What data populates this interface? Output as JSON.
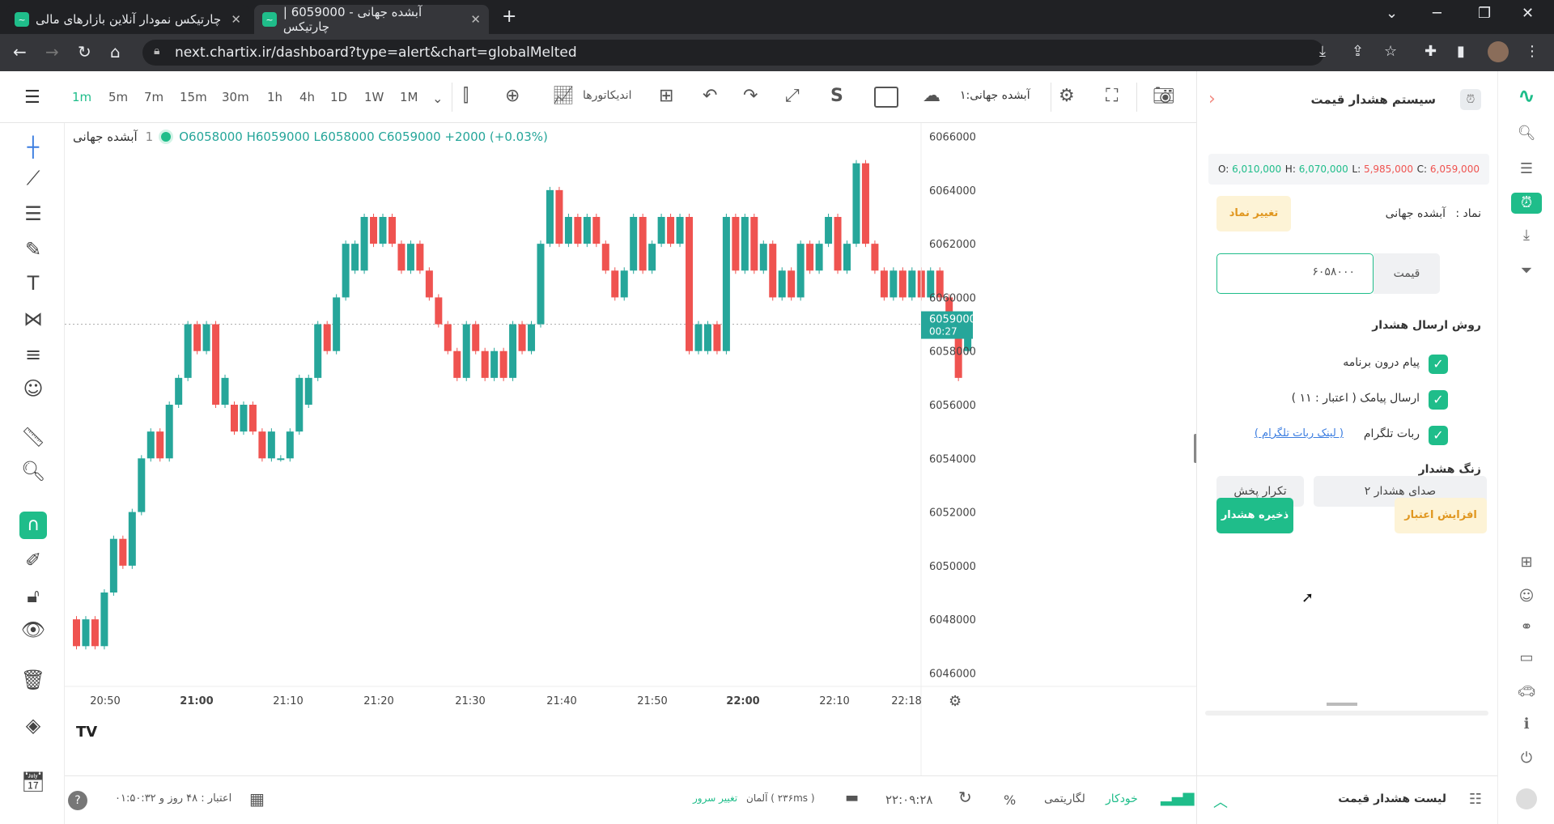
{
  "browser": {
    "tabs": [
      {
        "title": "چارتیکس نمودار آنلاین بازارهای مالی",
        "active": false
      },
      {
        "title": "آبشده جهانی - 6059000 | چارتیکس",
        "active": true
      }
    ],
    "url": "next.chartix.ir/dashboard?type=alert&chart=globalMelted"
  },
  "toolbar": {
    "timeframes": [
      "1m",
      "5m",
      "7m",
      "15m",
      "30m",
      "1h",
      "4h",
      "1D",
      "1W",
      "1M"
    ],
    "active_timeframe": "1m",
    "indicators_label": "اندیکاتورها",
    "symbol_label": "آبشده جهانی:۱",
    "s_label": "S"
  },
  "legend": {
    "symbol": "آبشده جهانی",
    "interval": "1",
    "ohlc": "O6058000 H6059000 L6058000 C6059000 +2000 (+0.03%)"
  },
  "chart_data": {
    "type": "candlestick",
    "x_ticks": [
      "20:50",
      "21:00",
      "21:10",
      "21:20",
      "21:30",
      "21:40",
      "21:50",
      "22:00",
      "22:10",
      "22:18"
    ],
    "y_ticks": [
      "6066000",
      "6064000",
      "6062000",
      "6060000",
      "6058000",
      "6056000",
      "6054000",
      "6052000",
      "6050000",
      "6048000",
      "6046000"
    ],
    "ylim": [
      6045500,
      6066500
    ],
    "last_price_label": "6059000",
    "countdown_label": "00:27",
    "up_color": "#26a69a",
    "down_color": "#ef5350",
    "candles": [
      [
        6048000,
        6047000
      ],
      [
        6047000,
        6048000
      ],
      [
        6048000,
        6047000
      ],
      [
        6047000,
        6049000
      ],
      [
        6049000,
        6051000
      ],
      [
        6051000,
        6050000
      ],
      [
        6050000,
        6052000
      ],
      [
        6052000,
        6054000
      ],
      [
        6054000,
        6055000
      ],
      [
        6055000,
        6054000
      ],
      [
        6054000,
        6056000
      ],
      [
        6056000,
        6057000
      ],
      [
        6057000,
        6059000
      ],
      [
        6059000,
        6058000
      ],
      [
        6058000,
        6059000
      ],
      [
        6059000,
        6056000
      ],
      [
        6056000,
        6057000
      ],
      [
        6056000,
        6055000
      ],
      [
        6055000,
        6056000
      ],
      [
        6056000,
        6055000
      ],
      [
        6055000,
        6054000
      ],
      [
        6054000,
        6055000
      ],
      [
        6054000,
        6054000
      ],
      [
        6054000,
        6055000
      ],
      [
        6055000,
        6057000
      ],
      [
        6056000,
        6057000
      ],
      [
        6057000,
        6059000
      ],
      [
        6059000,
        6058000
      ],
      [
        6058000,
        6060000
      ],
      [
        6060000,
        6062000
      ],
      [
        6061000,
        6062000
      ],
      [
        6061000,
        6063000
      ],
      [
        6063000,
        6062000
      ],
      [
        6062000,
        6063000
      ],
      [
        6063000,
        6062000
      ],
      [
        6062000,
        6061000
      ],
      [
        6061000,
        6062000
      ],
      [
        6062000,
        6061000
      ],
      [
        6061000,
        6060000
      ],
      [
        6060000,
        6059000
      ],
      [
        6059000,
        6058000
      ],
      [
        6058000,
        6057000
      ],
      [
        6057000,
        6059000
      ],
      [
        6059000,
        6058000
      ],
      [
        6058000,
        6057000
      ],
      [
        6057000,
        6058000
      ],
      [
        6058000,
        6057000
      ],
      [
        6057000,
        6059000
      ],
      [
        6059000,
        6058000
      ],
      [
        6058000,
        6059000
      ],
      [
        6059000,
        6062000
      ],
      [
        6062000,
        6064000
      ],
      [
        6064000,
        6062000
      ],
      [
        6062000,
        6063000
      ],
      [
        6063000,
        6062000
      ],
      [
        6062000,
        6063000
      ],
      [
        6063000,
        6062000
      ],
      [
        6062000,
        6061000
      ],
      [
        6061000,
        6060000
      ],
      [
        6060000,
        6061000
      ],
      [
        6061000,
        6063000
      ],
      [
        6063000,
        6061000
      ],
      [
        6061000,
        6062000
      ],
      [
        6062000,
        6063000
      ],
      [
        6063000,
        6062000
      ],
      [
        6062000,
        6063000
      ],
      [
        6063000,
        6058000
      ],
      [
        6058000,
        6059000
      ],
      [
        6058000,
        6059000
      ],
      [
        6059000,
        6058000
      ],
      [
        6058000,
        6063000
      ],
      [
        6063000,
        6061000
      ],
      [
        6061000,
        6063000
      ],
      [
        6063000,
        6061000
      ],
      [
        6061000,
        6062000
      ],
      [
        6062000,
        6060000
      ],
      [
        6060000,
        6061000
      ],
      [
        6061000,
        6060000
      ],
      [
        6060000,
        6062000
      ],
      [
        6062000,
        6061000
      ],
      [
        6061000,
        6062000
      ],
      [
        6062000,
        6063000
      ],
      [
        6063000,
        6061000
      ],
      [
        6061000,
        6062000
      ],
      [
        6062000,
        6065000
      ],
      [
        6065000,
        6062000
      ],
      [
        6062000,
        6061000
      ],
      [
        6061000,
        6060000
      ],
      [
        6060000,
        6061000
      ],
      [
        6061000,
        6060000
      ],
      [
        6060000,
        6061000
      ],
      [
        6061000,
        6060000
      ],
      [
        6060000,
        6061000
      ],
      [
        6061000,
        6060000
      ],
      [
        6060000,
        6059000
      ],
      [
        6059000,
        6057000
      ],
      [
        6058000,
        6059000
      ]
    ]
  },
  "bottombar": {
    "credit_label": "اعتبار : ۴۸ روز و ۰۱:۵۰:۳۲",
    "server_change": "تغییر سرور",
    "server_info": "آلمان ( ۲۳۶ms )",
    "time": "۲۲:۰۹:۲۸",
    "percent": "%",
    "log": "لگاریتمی",
    "auto": "خودکار"
  },
  "panel": {
    "title": "سیستم هشدار قیمت",
    "ohlc": {
      "o": "6,010,000",
      "h": "6,070,000",
      "l": "5,985,000",
      "c": "6,059,000"
    },
    "symbol_label": "نماد :",
    "symbol_value": "آبشده جهانی",
    "change_symbol": "تغییر نماد",
    "price_label": "قیمت",
    "price_value": "۶۰۵۸۰۰۰",
    "send_method_label": "روش ارسال هشدار",
    "opt_inapp": "پیام درون برنامه",
    "opt_sms": "ارسال پیامک ( اعتبار : ۱۱ )",
    "opt_telegram": "ربات تلگرام",
    "telegram_link": "( لینک ربات تلگرام )",
    "ring_label": "زنگ هشدار",
    "sound_select": "صدای هشدار ۲",
    "replay": "تکرار پخش",
    "increase_credit": "افزایش اعتبار",
    "save_alert": "ذخیره هشدار",
    "alert_list": "لیست هشدار قیمت"
  },
  "colors": {
    "accent": "#1fbd8a",
    "up": "#26a69a",
    "down": "#ef5350"
  }
}
